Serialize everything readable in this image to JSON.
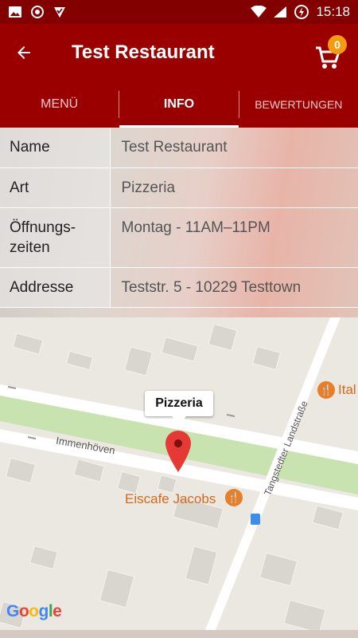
{
  "status_bar": {
    "time": "15:18"
  },
  "app_bar": {
    "title": "Test Restaurant",
    "cart_count": "0"
  },
  "tabs": [
    {
      "label": "MENÜ"
    },
    {
      "label": "INFO"
    },
    {
      "label": "BEWERTUNGEN"
    }
  ],
  "info": {
    "rows": [
      {
        "key": "Name",
        "value": "Test Restaurant"
      },
      {
        "key": "Art",
        "value": "Pizzeria"
      },
      {
        "key": "Öffnungs-zeiten",
        "value": "Montag - 11AM–11PM"
      },
      {
        "key": "Addresse",
        "value": "Teststr. 5 - 10229 Testtown"
      }
    ]
  },
  "map": {
    "marker_label": "Pizzeria",
    "street_1": "Immenhöven",
    "street_2": "Tangstedter Landstraße",
    "poi_1": "Eiscafe Jacobs",
    "poi_2": "Ital",
    "attribution": "Google"
  },
  "colors": {
    "primary": "#9b0000",
    "status": "#830000",
    "badge": "#f39c12",
    "poi": "#e87e26",
    "marker": "#e53935"
  }
}
